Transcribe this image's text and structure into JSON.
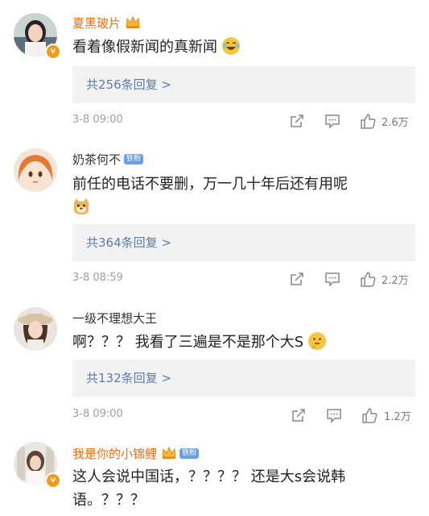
{
  "comments": [
    {
      "user": "夏黑玻片",
      "text": "看着像假新闻的真新闻",
      "replies": "共256条回复 >",
      "time": "3-8 09:00",
      "likes": "2.6万"
    },
    {
      "user": "奶茶何不",
      "badge": "铁粉",
      "text": "前任的电话不要删，万一几十年后还有用呢",
      "replies": "共364条回复 >",
      "time": "3-8 08:59",
      "likes": "2.2万"
    },
    {
      "user": "一级不理想大王",
      "text": "啊？？？ 我看了三遍是不是那个大S",
      "replies": "共132条回复 >",
      "time": "3-8 09:00",
      "likes": "1.2万"
    },
    {
      "user": "我是你的小锦鲤",
      "badge": "铁粉",
      "text": "这人会说中国话，？？？？ 还是大s会说韩语。？？？"
    }
  ],
  "colors": {
    "vip_name": "#f86b0e",
    "reply_link": "#5d7bad",
    "reply_bg": "#f2f2f2",
    "meta": "#a0a0a0"
  },
  "icons": [
    "share-icon",
    "comment-icon",
    "like-icon",
    "crown-icon",
    "laugh-cry-emoji",
    "doge-emoji",
    "thinking-emoji"
  ]
}
